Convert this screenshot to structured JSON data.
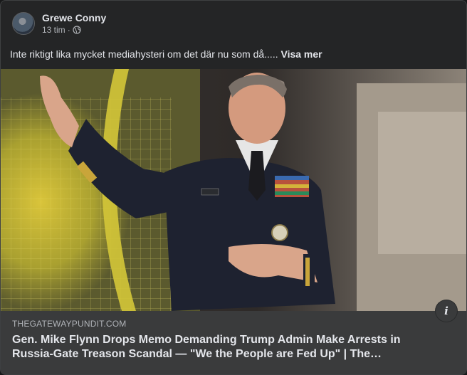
{
  "post": {
    "author": "Grewe Conny",
    "time": "13 tim",
    "separator": "·",
    "audience_icon": "globe-icon",
    "text": "Inte riktigt lika mycket mediahysteri om det där nu som då..... ",
    "see_more": "Visa mer"
  },
  "link_preview": {
    "domain": "THEGATEWAYPUNDIT.COM",
    "headline": "Gen. Mike Flynn Drops Memo Demanding Trump Admin Make Arrests in Russia-Gate Treason Scandal — \"We the People are Fed Up\" | The…",
    "info_icon": "info-icon"
  },
  "colors": {
    "card_bg": "#242526",
    "link_bar_bg": "#3a3b3c",
    "primary_text": "#e4e6eb",
    "secondary_text": "#b0b3b8"
  }
}
